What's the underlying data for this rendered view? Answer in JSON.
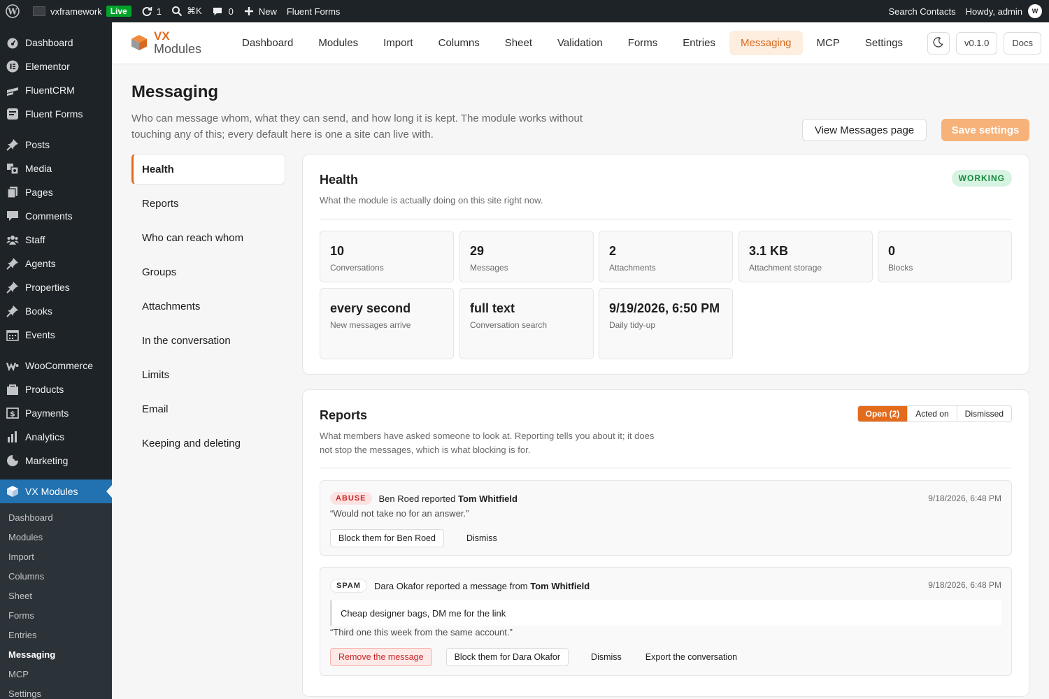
{
  "adminbar": {
    "site_name": "vxframework",
    "live_label": "Live",
    "updates_count": "1",
    "shortcut": "⌘K",
    "comments_count": "0",
    "new_label": "New",
    "fluent_forms": "Fluent Forms",
    "search_contacts": "Search Contacts",
    "howdy": "Howdy, admin"
  },
  "sidebar": {
    "items": [
      {
        "label": "Dashboard",
        "icon": "dashboard-icon"
      },
      {
        "label": "Elementor",
        "icon": "elementor-icon"
      },
      {
        "label": "FluentCRM",
        "icon": "fluentcrm-icon"
      },
      {
        "label": "Fluent Forms",
        "icon": "fluent-forms-icon"
      },
      {
        "label": "Posts",
        "icon": "pin-icon"
      },
      {
        "label": "Media",
        "icon": "media-icon"
      },
      {
        "label": "Pages",
        "icon": "pages-icon"
      },
      {
        "label": "Comments",
        "icon": "comments-icon"
      },
      {
        "label": "Staff",
        "icon": "staff-icon"
      },
      {
        "label": "Agents",
        "icon": "pin-icon"
      },
      {
        "label": "Properties",
        "icon": "pin-icon"
      },
      {
        "label": "Books",
        "icon": "pin-icon"
      },
      {
        "label": "Events",
        "icon": "calendar-icon"
      },
      {
        "label": "WooCommerce",
        "icon": "woocommerce-icon"
      },
      {
        "label": "Products",
        "icon": "products-icon"
      },
      {
        "label": "Payments",
        "icon": "payments-icon"
      },
      {
        "label": "Analytics",
        "icon": "analytics-icon"
      },
      {
        "label": "Marketing",
        "icon": "marketing-icon"
      },
      {
        "label": "VX Modules",
        "icon": "cube-icon"
      }
    ],
    "submenu": [
      "Dashboard",
      "Modules",
      "Import",
      "Columns",
      "Sheet",
      "Forms",
      "Entries",
      "Messaging",
      "MCP",
      "Settings"
    ]
  },
  "topnav": {
    "brand_vx": "VX",
    "brand_sub": "Modules",
    "items": [
      "Dashboard",
      "Modules",
      "Import",
      "Columns",
      "Sheet",
      "Validation",
      "Forms",
      "Entries",
      "Messaging",
      "MCP",
      "Settings"
    ],
    "active": "Messaging",
    "version": "v0.1.0",
    "docs": "Docs"
  },
  "page": {
    "title": "Messaging",
    "description": "Who can message whom, what they can send, and how long it is kept. The module works without touching any of this; every default here is one a site can live with.",
    "view_messages": "View Messages page",
    "save_settings": "Save settings"
  },
  "subnav": [
    "Health",
    "Reports",
    "Who can reach whom",
    "Groups",
    "Attachments",
    "In the conversation",
    "Limits",
    "Email",
    "Keeping and deleting"
  ],
  "health": {
    "title": "Health",
    "badge": "WORKING",
    "description": "What the module is actually doing on this site right now.",
    "stats": [
      {
        "value": "10",
        "label": "Conversations"
      },
      {
        "value": "29",
        "label": "Messages"
      },
      {
        "value": "2",
        "label": "Attachments"
      },
      {
        "value": "3.1 KB",
        "label": "Attachment storage"
      },
      {
        "value": "0",
        "label": "Blocks"
      }
    ],
    "stats2": [
      {
        "value": "every second",
        "label": "New messages arrive"
      },
      {
        "value": "full text",
        "label": "Conversation search"
      },
      {
        "value": "9/19/2026, 6:50 PM",
        "label": "Daily tidy-up"
      }
    ]
  },
  "reports": {
    "title": "Reports",
    "description": "What members have asked someone to look at. Reporting tells you about it; it does not stop the messages, which is what blocking is for.",
    "tabs": [
      "Open (2)",
      "Acted on",
      "Dismissed"
    ],
    "items": [
      {
        "tag": "ABUSE",
        "reporter": "Ben Roed",
        "verb": " reported ",
        "target": "Tom Whitfield",
        "date": "9/18/2026, 6:48 PM",
        "quote": "“Would not take no for an answer.”",
        "actions": [
          "Block them for Ben Roed",
          "Dismiss"
        ]
      },
      {
        "tag": "SPAM",
        "reporter": "Dara Okafor",
        "verb": " reported a message from ",
        "target": "Tom Whitfield",
        "date": "9/18/2026, 6:48 PM",
        "message": "Cheap designer bags, DM me for the link",
        "quote": "“Third one this week from the same account.”",
        "actions": [
          "Remove the message",
          "Block them for Dara Okafor",
          "Dismiss",
          "Export the conversation"
        ]
      }
    ]
  }
}
